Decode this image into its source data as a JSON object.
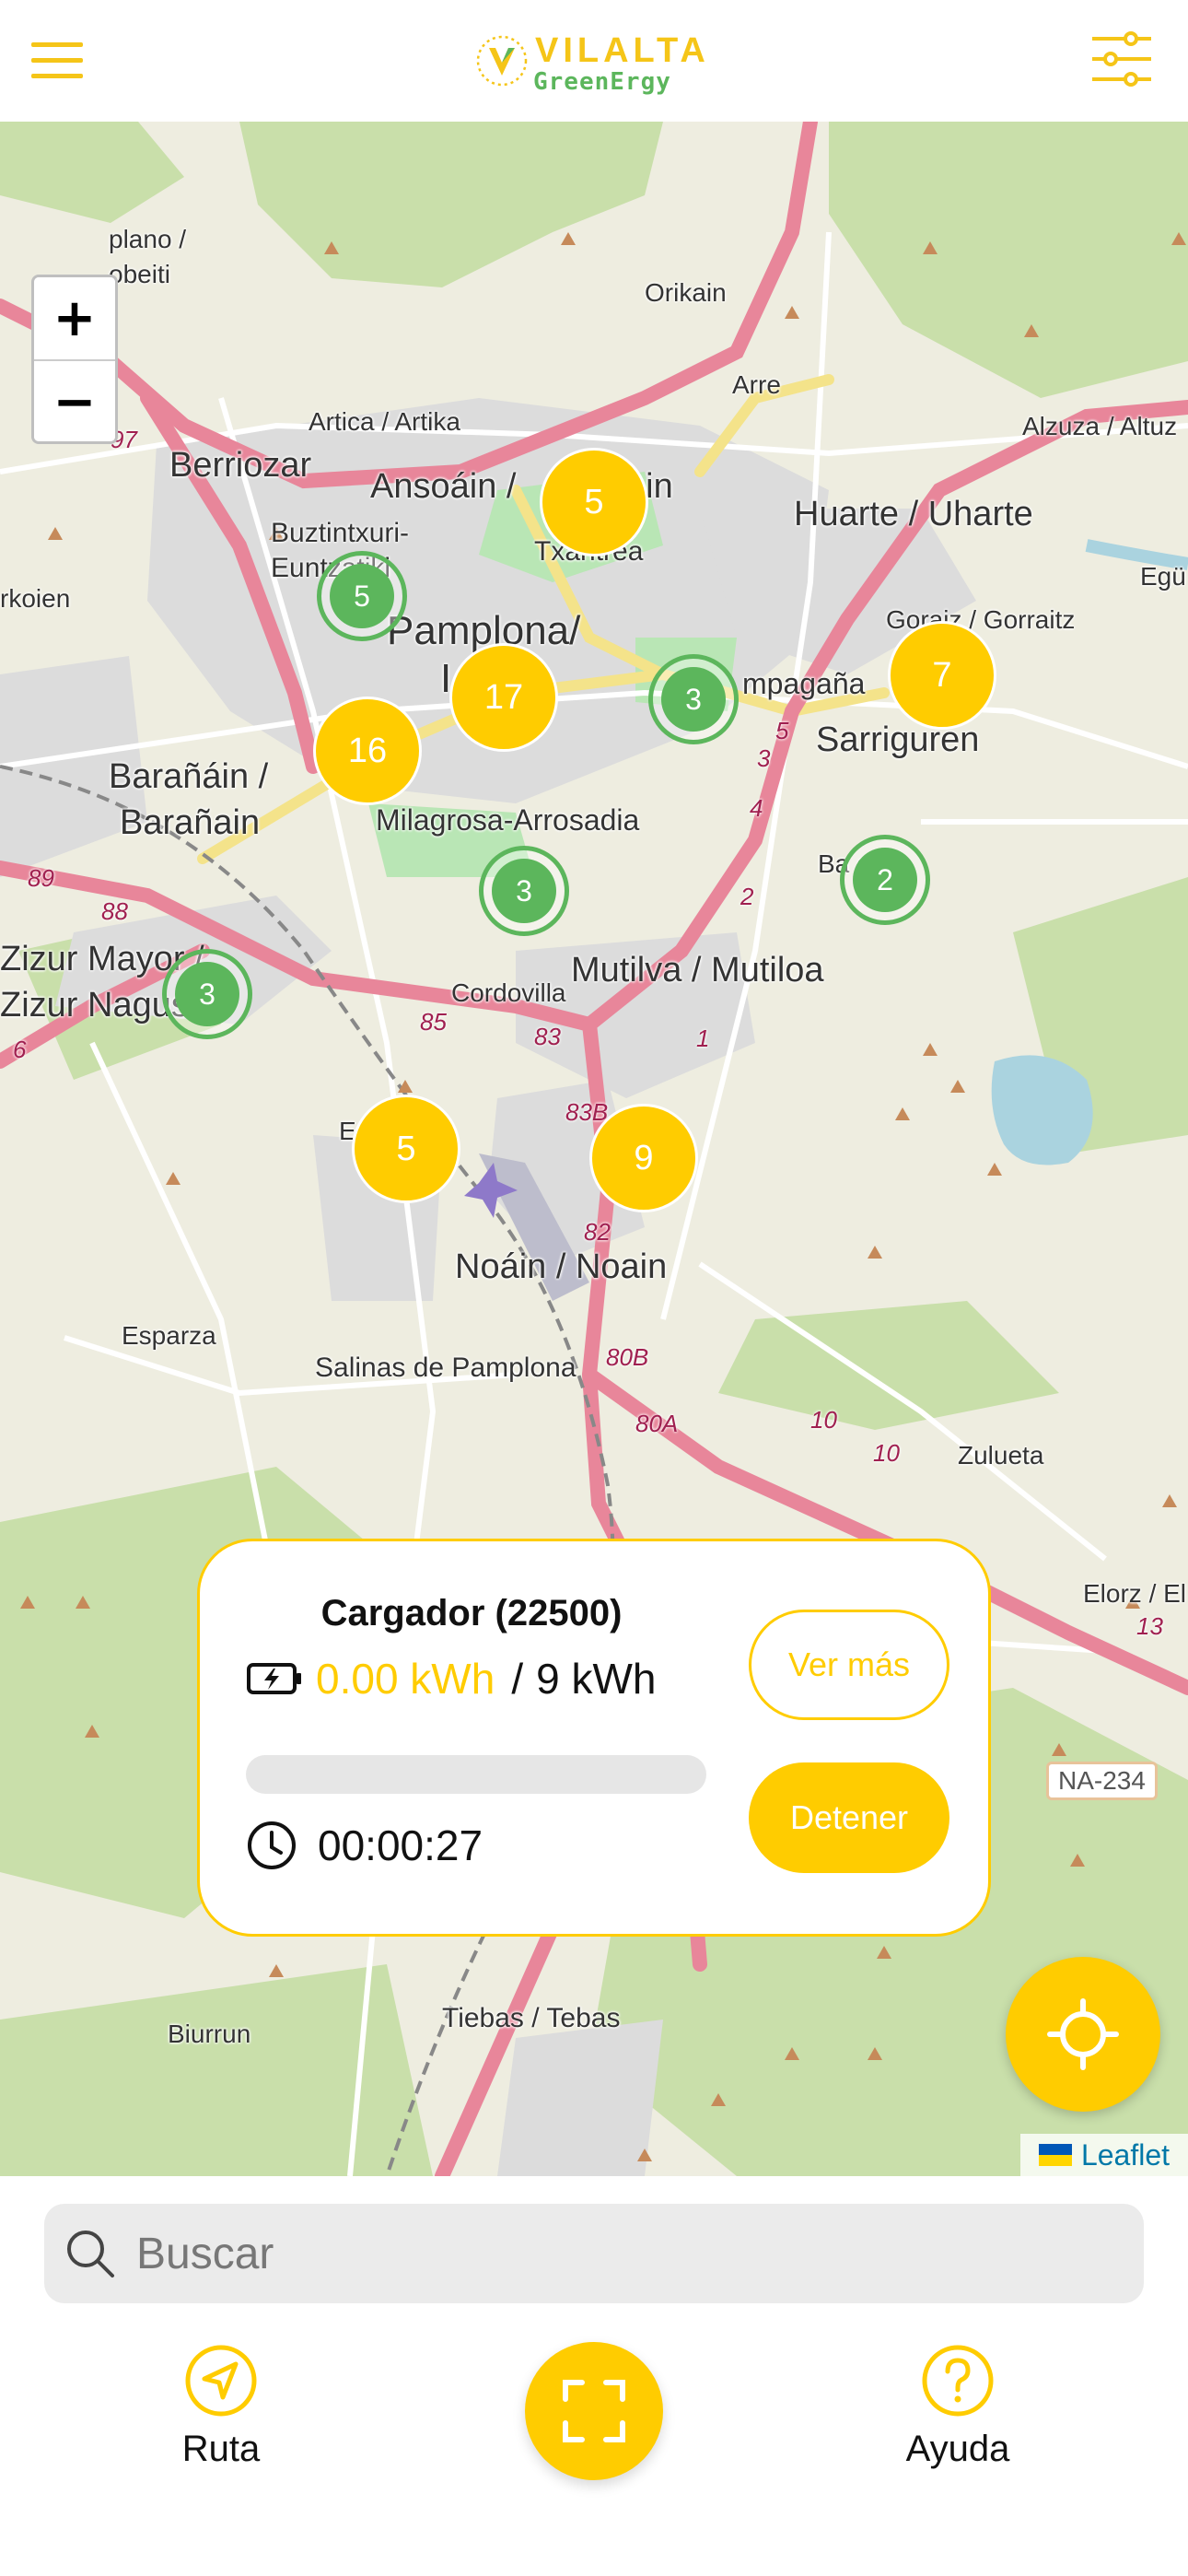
{
  "header": {
    "logo": {
      "line1": "VILALTA",
      "line2": "GreenErgy"
    },
    "menu_icon": "hamburger-icon",
    "filter_icon": "sliders-icon"
  },
  "colors": {
    "accent": "#FFCC00",
    "green": "#5CB65C",
    "road": "#E8869A"
  },
  "map": {
    "zoom_in": "+",
    "zoom_out": "−",
    "attribution": "Leaflet",
    "places": {
      "plano": "plano /",
      "obeiti": "obeiti",
      "orikain": "Orikain",
      "arre": "Arre",
      "artica": "Artica / Artika",
      "alzuza": "Alzuza / Altuz",
      "berriozar": "Berriozar",
      "ansoain": "Ansoáin /",
      "ain": "ain",
      "huarte": "Huarte / Uharte",
      "buztintxuri": "Buztintxuri-",
      "euntzatiki": "Euntzatiki",
      "txantrea": "Txantrea",
      "egu": "Egü",
      "rkoien": "rkoien",
      "pamplona": "Pamplona/",
      "i": "I",
      "gorraiz": "Goraiz / Gorraitz",
      "mendillorri": "mpagaña",
      "sarriguren": "Sarriguren",
      "baranain1": "Barañáin /",
      "baranain2": "Barañain",
      "milagrosa": "Milagrosa-Arrosadia",
      "badostain": "Ba   ain",
      "zizur1": "Zizur Mayor /",
      "zizur2": "Zizur Nagus",
      "mutilva": "Mutilva / Mutiloa",
      "cordovilla": "Cordovilla",
      "e": "E",
      "noain": "Noáin / Noain",
      "esparza": "Esparza",
      "salinas": "Salinas de Pamplona",
      "zulueta": "Zulueta",
      "elorz": "Elorz / El",
      "biurrun": "Biurrun",
      "tiebas": "Tiebas / Tebas"
    },
    "roads": {
      "r97a": "97",
      "r97b": "97",
      "r89": "89",
      "r88": "88",
      "r6": "6",
      "r85": "85",
      "r83": "83",
      "r83b": "83B",
      "r82": "82",
      "r80b": "80B",
      "r80a": "80A",
      "r10a": "10",
      "r10b": "10",
      "r13": "13",
      "r5": "5",
      "r3": "3",
      "r4": "4",
      "r2": "2",
      "r1": "1",
      "na234": "NA-234"
    },
    "clusters": {
      "c1": "5",
      "c2": "5",
      "c3": "17",
      "c4": "3",
      "c5": "7",
      "c6": "16",
      "c7": "3",
      "c8": "2",
      "c9": "3",
      "c10": "5",
      "c11": "9"
    },
    "locate_icon": "crosshair-icon"
  },
  "charger_card": {
    "title": "Cargador (22500)",
    "energy_current": "0.00 kWh",
    "energy_separator": "/",
    "energy_max": "9 kWh",
    "progress": 0,
    "elapsed": "00:00:27",
    "more_label": "Ver más",
    "stop_label": "Detener"
  },
  "bottom": {
    "search_placeholder": "Buscar",
    "nav": {
      "route_label": "Ruta",
      "help_label": "Ayuda"
    },
    "scan_icon": "scan-icon"
  }
}
